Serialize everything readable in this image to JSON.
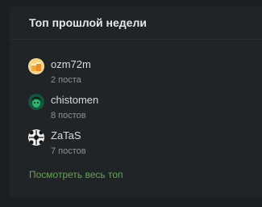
{
  "widget": {
    "title": "Топ прошлой недели",
    "users": [
      {
        "name": "ozm72m",
        "count": "2 поста",
        "icon": "drink-avatar-icon"
      },
      {
        "name": "chistomen",
        "count": "8 постов",
        "icon": "green-face-avatar-icon"
      },
      {
        "name": "ZaTaS",
        "count": "7 постов",
        "icon": "pattern-avatar-icon"
      }
    ],
    "more_label": "Посмотреть весь топ"
  },
  "colors": {
    "background": "#1c1f21",
    "card": "#212426",
    "link": "#68a058",
    "title": "#e5e7e9",
    "muted": "#8d9196"
  }
}
